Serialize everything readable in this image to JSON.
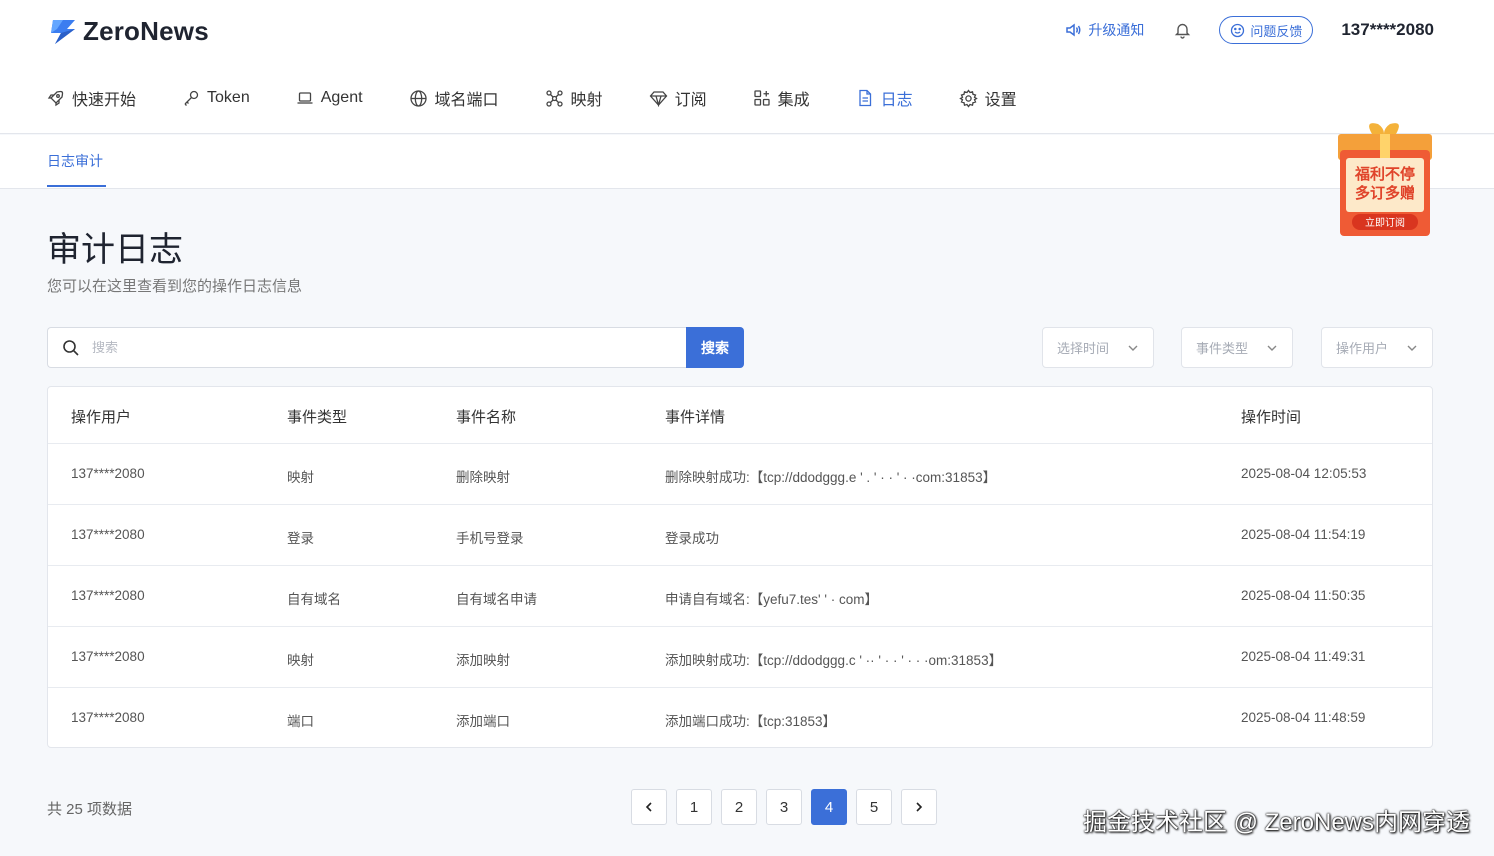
{
  "brand": {
    "name": "ZeroNews"
  },
  "topbar": {
    "upgrade_label": "升级通知",
    "feedback_label": "问题反馈",
    "user": "137****2080"
  },
  "nav": {
    "items": [
      {
        "label": "快速开始",
        "icon": "rocket-icon"
      },
      {
        "label": "Token",
        "icon": "key-icon"
      },
      {
        "label": "Agent",
        "icon": "laptop-icon"
      },
      {
        "label": "域名端口",
        "icon": "globe-icon"
      },
      {
        "label": "映射",
        "icon": "network-icon"
      },
      {
        "label": "订阅",
        "icon": "diamond-icon"
      },
      {
        "label": "集成",
        "icon": "grid-icon"
      },
      {
        "label": "日志",
        "icon": "document-icon"
      },
      {
        "label": "设置",
        "icon": "gear-icon"
      }
    ],
    "active": "日志"
  },
  "subnav": {
    "tab": "日志审计"
  },
  "promo": {
    "line1": "福利不停",
    "line2": "多订多赠",
    "button": "立即订阅"
  },
  "page": {
    "title": "审计日志",
    "subtitle": "您可以在这里查看到您的操作日志信息"
  },
  "search": {
    "placeholder": "搜索",
    "button_label": "搜索"
  },
  "filters": {
    "time": "选择时间",
    "event_type": "事件类型",
    "operator": "操作用户"
  },
  "table": {
    "columns": [
      "操作用户",
      "事件类型",
      "事件名称",
      "事件详情",
      "操作时间"
    ],
    "rows": [
      [
        "137****2080",
        "映射",
        "删除映射",
        "删除映射成功:【tcp://ddodggg.e ' .  ' · · ' · ·com:31853】",
        "2025-08-04 12:05:53"
      ],
      [
        "137****2080",
        "登录",
        "手机号登录",
        "登录成功",
        "2025-08-04 11:54:19"
      ],
      [
        "137****2080",
        "自有域名",
        "自有域名申请",
        "申请自有域名:【yefu7.tes'     ' ·  com】",
        "2025-08-04 11:50:35"
      ],
      [
        "137****2080",
        "映射",
        "添加映射",
        "添加映射成功:【tcp://ddodggg.c ' ·· ' · · ' · · ·om:31853】",
        "2025-08-04 11:49:31"
      ],
      [
        "137****2080",
        "端口",
        "添加端口",
        "添加端口成功:【tcp:31853】",
        "2025-08-04 11:48:59"
      ]
    ]
  },
  "pagination": {
    "total_text": "共 25 项数据",
    "pages": [
      "1",
      "2",
      "3",
      "4",
      "5"
    ],
    "current": "4"
  },
  "watermark": "掘金技术社区 @ ZeroNews内网穿透",
  "colors": {
    "accent": "#3b6fd8",
    "promo": "#e9533a"
  }
}
